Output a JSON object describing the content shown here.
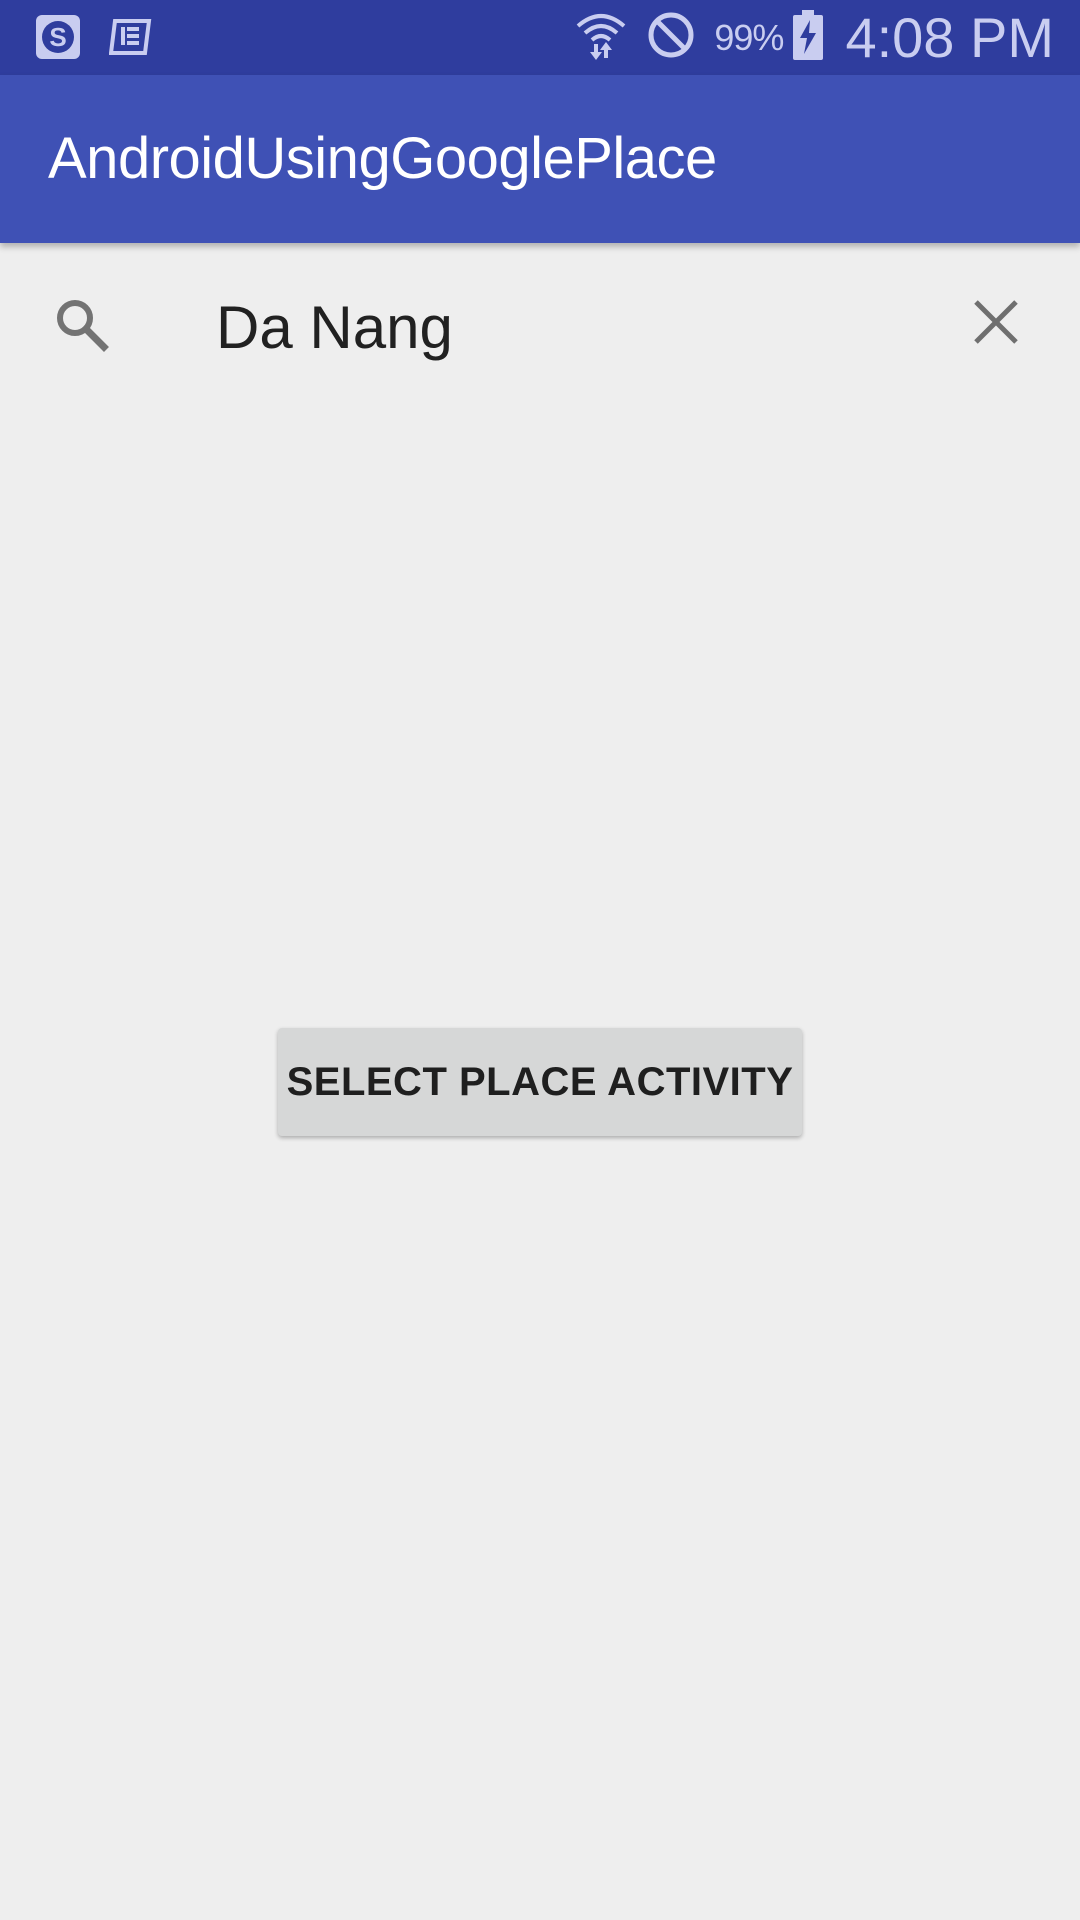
{
  "status_bar": {
    "left_icons": [
      "skype-icon",
      "news-app-icon"
    ],
    "wifi_icon": "wifi-icon",
    "dnd_icon": "do-not-disturb-icon",
    "battery_percent": "99%",
    "battery_icon": "battery-charging-icon",
    "time": "4:08 PM"
  },
  "app_bar": {
    "title": "AndroidUsingGooglePlace",
    "color": "#3f51b5"
  },
  "search": {
    "icon": "search-icon",
    "value": "Da Nang",
    "clear_icon": "close-icon"
  },
  "main": {
    "select_button_label": "SELECT PLACE ACTIVITY"
  },
  "colors": {
    "status_bar": "#2f3d9e",
    "app_bar": "#3f51b5",
    "background": "#eeeeee",
    "button": "#d6d7d7"
  }
}
